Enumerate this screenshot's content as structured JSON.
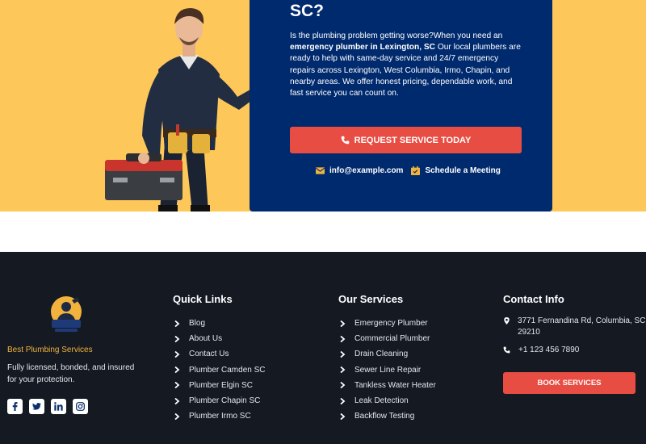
{
  "hero": {
    "title": "SC?",
    "body_pre": "Is the plumbing problem getting worse?When you need an ",
    "body_bold": "emergency plumber in Lexington, SC",
    "body_post": " Our local plumbers are ready to help with same-day service and 24/7 emergency repairs across Lexington, West Columbia, Irmo, Chapin, and nearby areas. We offer honest pricing, dependable work, and fast service you can count on.",
    "cta_label": "REQUEST SERVICE TODAY",
    "email": "info@example.com",
    "schedule": "Schedule a Meeting"
  },
  "footer": {
    "brand": "Best Plumbing Services",
    "about": "Fully licensed, bonded, and insured for your protection.",
    "quick_links": {
      "title": "Quick Links",
      "items": [
        "Blog",
        "About Us",
        "Contact Us",
        "Plumber Camden SC",
        "Plumber Elgin SC",
        "Plumber Chapin SC",
        "Plumber Irmo SC"
      ]
    },
    "services": {
      "title": "Our Services",
      "items": [
        "Emergency Plumber",
        "Commercial Plumber",
        "Drain Cleaning",
        "Sewer Line Repair",
        "Tankless Water Heater",
        "Leak Detection",
        "Backflow Testing"
      ]
    },
    "contact": {
      "title": "Contact Info",
      "address": "3771 Fernandina Rd, Columbia, SC 29210",
      "phone": "+1 123 456 7890",
      "book_label": "BOOK SERVICES"
    },
    "socials": [
      "facebook-icon",
      "twitter-icon",
      "linkedin-icon",
      "instagram-icon"
    ]
  },
  "colors": {
    "hero_bg": "#fec75a",
    "card_bg": "#002a6e",
    "accent": "#e84d43",
    "footer_bg": "#141922",
    "brand": "#f2b33d"
  }
}
